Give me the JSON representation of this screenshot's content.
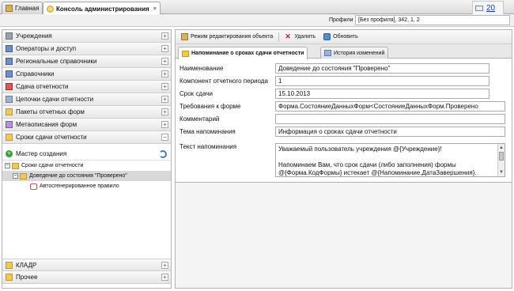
{
  "tabs": {
    "home": "Главная",
    "console": "Консоль администрирования",
    "close": "×"
  },
  "notifications": {
    "count": "20"
  },
  "profile": {
    "label": "Профили",
    "value": "[Без профиля], 342, 1, 2"
  },
  "sidebar": {
    "top_items": [
      {
        "label": "Учреждения",
        "icon": "building-icon"
      },
      {
        "label": "Операторы и доступ",
        "icon": "users-icon"
      },
      {
        "label": "Региональные справочники",
        "icon": "book-icon"
      },
      {
        "label": "Справочники",
        "icon": "book-icon"
      },
      {
        "label": "Сдача отчетности",
        "icon": "tools-icon"
      },
      {
        "label": "Цепочки сдачи отчетности",
        "icon": "chain-icon"
      },
      {
        "label": "Пакеты отчетных форм",
        "icon": "folder-icon"
      },
      {
        "label": "Метаописания форм",
        "icon": "forms-icon"
      },
      {
        "label": "Сроки сдачи отчетности",
        "icon": "folder-icon"
      }
    ],
    "expand": "+",
    "collapse": "−",
    "master": "Мастер создания",
    "tree": {
      "root": "Сроки сдачи отчетности",
      "child": "Доведение до состояния \"Проверено\"",
      "leaf": "Автосгенерированное правило"
    },
    "bottom_items": [
      {
        "label": "КЛАДР",
        "icon": "folder-icon"
      },
      {
        "label": "Прочее",
        "icon": "folder-icon"
      }
    ]
  },
  "toolbar": {
    "edit": "Режим редактирования объекта",
    "delete": "Удалить",
    "refresh": "Обновить"
  },
  "subtabs": {
    "reminder": "Напоминание о сроках сдачи отчетности",
    "history": "История изменений"
  },
  "form": {
    "fields": [
      {
        "label": "Наименование",
        "value": "Доведение до состояния \"Проверено\""
      },
      {
        "label": "Компонент отчетного периода",
        "value": "1"
      },
      {
        "label": "Срок сдачи",
        "value": "15.10.2013"
      },
      {
        "label": "Требования к форме",
        "value": "Форма.СостояниеДанныхФорм<СостояниеДанныхФорм.Проверено"
      },
      {
        "label": "Комментарий",
        "value": ""
      },
      {
        "label": "Тема напоминания",
        "value": "Информация о сроках сдачи отчетности"
      },
      {
        "label": "Текст напоминания",
        "value": ""
      }
    ],
    "text_lines": [
      "Уважаемый пользователь учреждения @{Учреждение}!",
      "",
      "Напоминаем Вам, что срок сдачи (либо заполнения) формы",
      "@{Форма.КодФормы} истекает @{Напоминание.ДатаЗавершения}."
    ]
  }
}
